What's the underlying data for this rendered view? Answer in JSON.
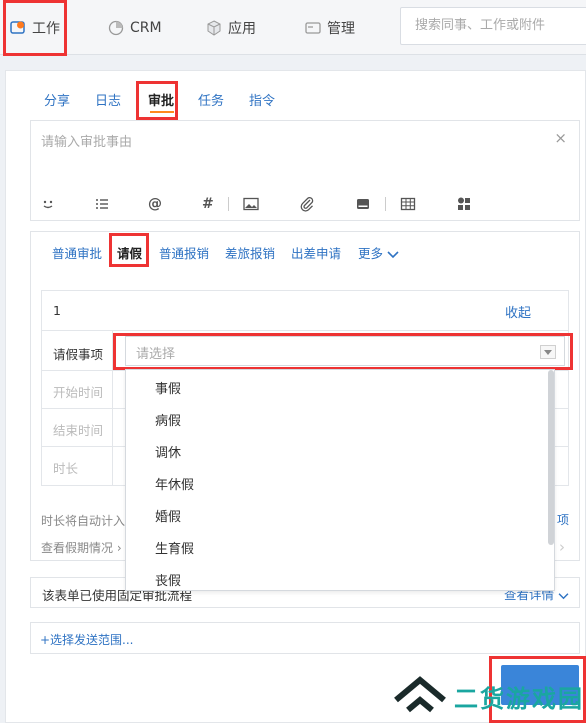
{
  "topnav": {
    "items": [
      {
        "label": "工作",
        "icon": "work-bubble-icon"
      },
      {
        "label": "CRM",
        "icon": "pie-icon"
      },
      {
        "label": "应用",
        "icon": "cube-icon"
      },
      {
        "label": "管理",
        "icon": "card-icon"
      }
    ],
    "search_placeholder": "搜索同事、工作或附件"
  },
  "tabs": [
    "分享",
    "日志",
    "审批",
    "任务",
    "指令"
  ],
  "composer": {
    "placeholder": "请输入审批事由",
    "close": "×"
  },
  "approval_tabs": [
    "普通审批",
    "请假",
    "普通报销",
    "差旅报销",
    "出差申请",
    "更多"
  ],
  "form": {
    "index": "1",
    "collapse": "收起",
    "fields": {
      "leave_type": "请假事项",
      "start": "开始时间",
      "end": "结束时间",
      "duration": "时长"
    },
    "select_placeholder": "请选择",
    "hint_left": "时长将自动计入",
    "hint_right": "项",
    "view_leave": "查看假期情况"
  },
  "dropdown": {
    "options": [
      "事假",
      "病假",
      "调休",
      "年休假",
      "婚假",
      "生育假",
      "丧假"
    ]
  },
  "workflow": {
    "text": "该表单已使用固定审批流程",
    "details": "查看详情"
  },
  "send_scope": "+选择发送范围...",
  "watermark": "二货游戏园",
  "colors": {
    "accent": "#2f73c3",
    "highlight": "#e33",
    "underline": "#ff8a1e"
  }
}
